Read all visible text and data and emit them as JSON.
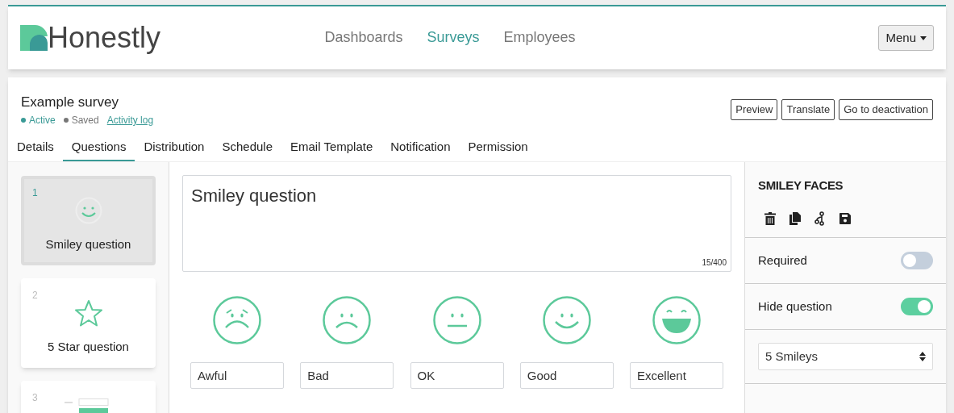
{
  "brand": {
    "name": "Honestly"
  },
  "nav": [
    {
      "label": "Dashboards",
      "selected": false
    },
    {
      "label": "Surveys",
      "selected": true
    },
    {
      "label": "Employees",
      "selected": false
    }
  ],
  "menu_button": "Menu",
  "survey": {
    "title": "Example survey",
    "status": "Active",
    "save_state": "Saved",
    "activity_link": "Activity log"
  },
  "actions": [
    "Preview",
    "Translate",
    "Go to deactivation"
  ],
  "tabs": [
    {
      "label": "Details",
      "selected": false
    },
    {
      "label": "Questions",
      "selected": true
    },
    {
      "label": "Distribution",
      "selected": false
    },
    {
      "label": "Schedule",
      "selected": false
    },
    {
      "label": "Email Template",
      "selected": false
    },
    {
      "label": "Notification",
      "selected": false
    },
    {
      "label": "Permission",
      "selected": false
    }
  ],
  "questions": [
    {
      "number": "1",
      "kind": "smiley",
      "title": "Smiley question",
      "selected": true
    },
    {
      "number": "2",
      "kind": "star",
      "title": "5 Star question",
      "selected": false
    },
    {
      "number": "3",
      "kind": "form",
      "selected": false
    }
  ],
  "editor": {
    "question_text": "Smiley question",
    "counter": "15/400",
    "faces": [
      {
        "kind": "awful",
        "label": "Awful"
      },
      {
        "kind": "bad",
        "label": "Bad"
      },
      {
        "kind": "ok",
        "label": "OK"
      },
      {
        "kind": "good",
        "label": "Good"
      },
      {
        "kind": "excellent",
        "label": "Excellent"
      }
    ]
  },
  "settings": {
    "heading": "SMILEY FACES",
    "toggles": [
      {
        "label": "Required",
        "on": false
      },
      {
        "label": "Hide question",
        "on": true
      }
    ],
    "scale_select": "5 Smileys"
  }
}
